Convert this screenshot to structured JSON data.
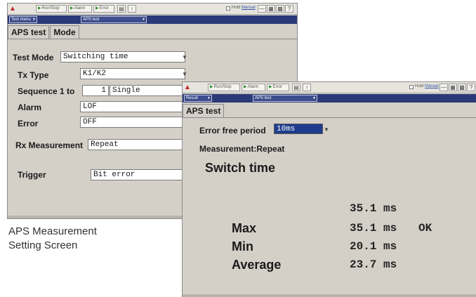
{
  "caption": {
    "line1": "APS Measurement",
    "line2": "Setting Screen"
  },
  "toolbar": {
    "run_stop": "Run/Stop",
    "alarm": "Alarm",
    "error": "Error",
    "check_label": "Hold",
    "check_link": "Manual"
  },
  "window_a": {
    "sub_select_1": "Test menu",
    "sub_select_2": "APS test",
    "tabs": [
      "APS test",
      "Mode"
    ],
    "test_mode": {
      "label": "Test Mode",
      "value": "Switching time"
    },
    "tx_type": {
      "label": "Tx Type",
      "value": "K1/K2"
    },
    "sequence": {
      "label": "Sequence 1 to",
      "count": "1",
      "mode": "Single"
    },
    "alarm": {
      "label": "Alarm",
      "value": "LOF"
    },
    "error": {
      "label": "Error",
      "value": "OFF"
    },
    "rx_measurement": {
      "label": "Rx Measurement",
      "value": "Repeat"
    },
    "trigger": {
      "label": "Trigger",
      "value": "Bit error"
    }
  },
  "window_b": {
    "sub_select_1": "Result",
    "sub_select_2": "APS test",
    "tab": "APS test",
    "error_free_period": {
      "label": "Error free period",
      "value": "10ms"
    },
    "measurement_mode": "Measurement:Repeat",
    "switch_time_title": "Switch time",
    "current_value": "35.1 ms",
    "rows": [
      {
        "label": "Max",
        "value": "35.1 ms",
        "status": "OK"
      },
      {
        "label": "Min",
        "value": "20.1 ms",
        "status": ""
      },
      {
        "label": "Average",
        "value": "23.7 ms",
        "status": ""
      }
    ]
  }
}
